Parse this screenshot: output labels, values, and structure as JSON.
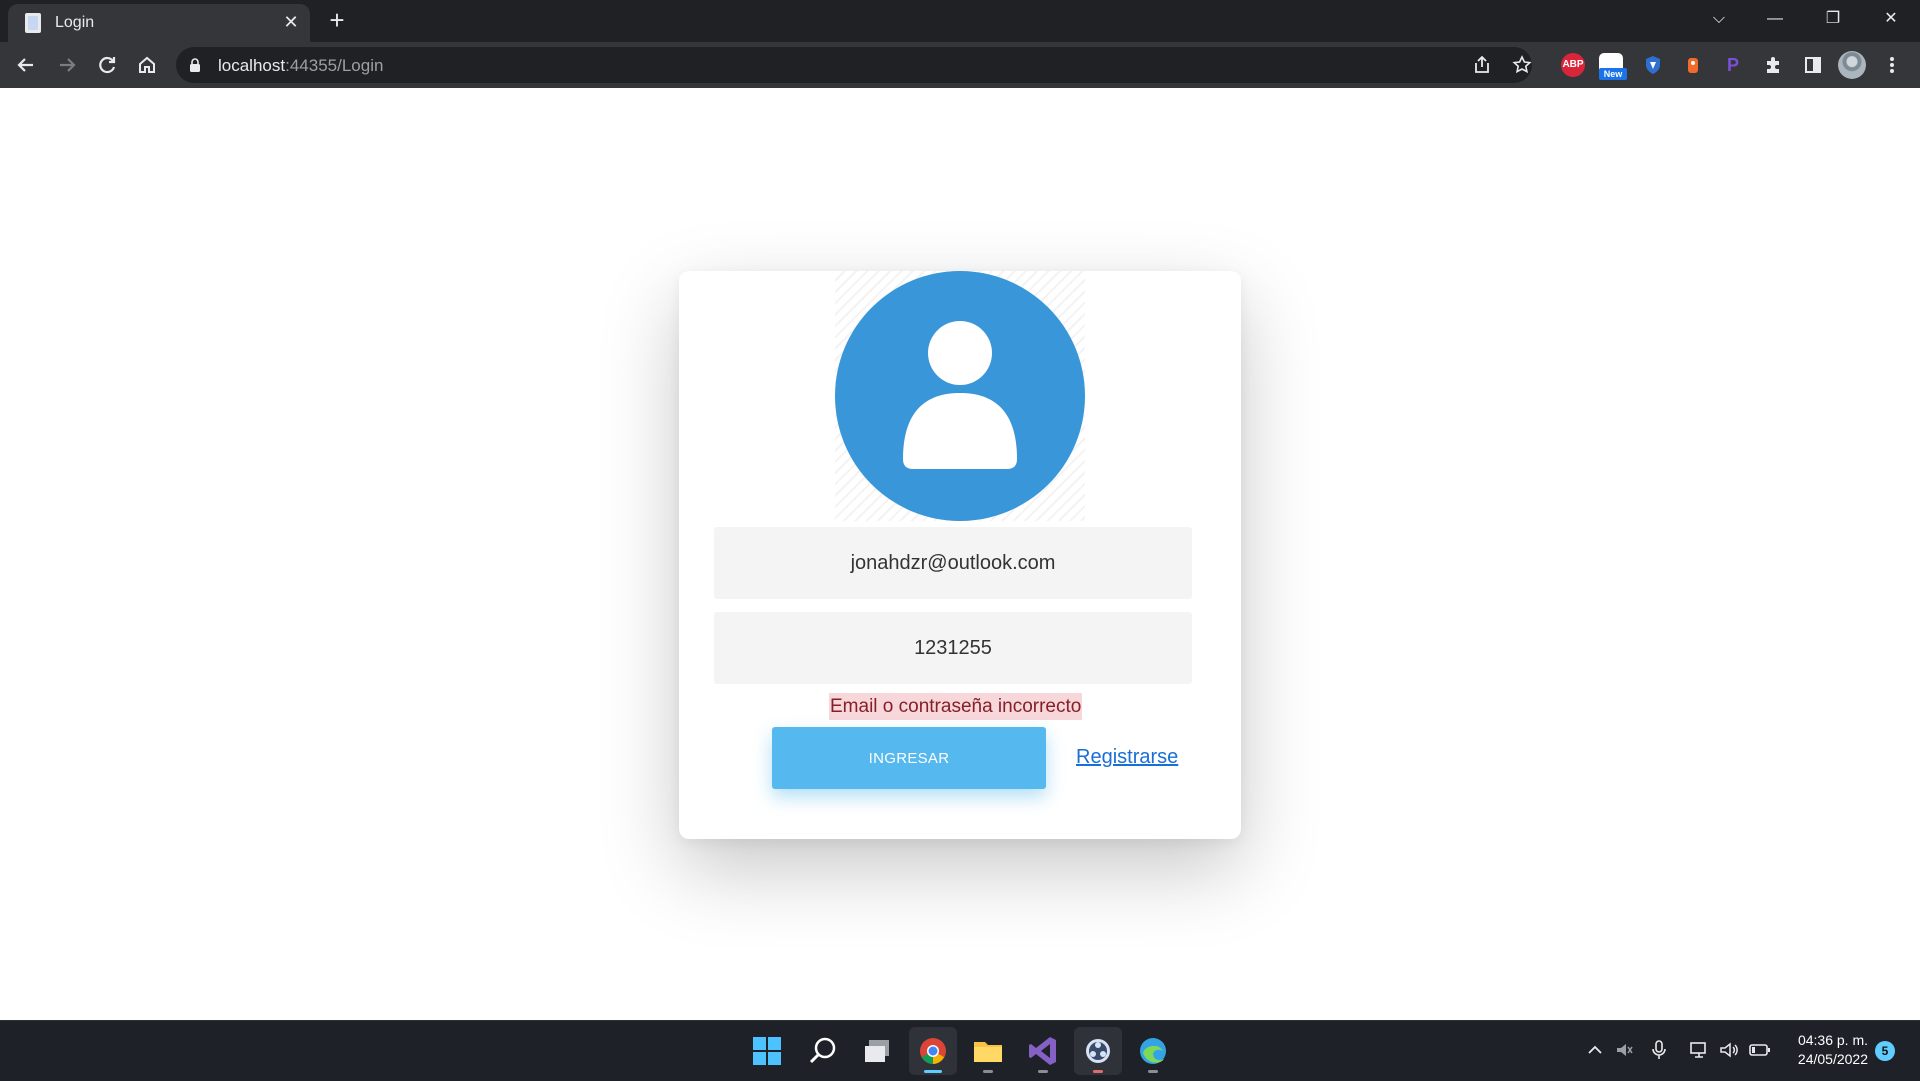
{
  "browser": {
    "tab_title": "Login",
    "tab_close": "✕",
    "new_tab": "+",
    "url_host": "localhost",
    "url_rest": ":44355/Login",
    "window_controls": [
      "⌵",
      "—",
      "❐",
      "✕"
    ],
    "extensions": [
      {
        "name": "adblock-plus-icon",
        "label": "ABP",
        "color": "#d9253a"
      },
      {
        "name": "new-extension-icon",
        "label": "",
        "badge": "New",
        "color": "#ffffff"
      },
      {
        "name": "shield-extension-icon",
        "label": "",
        "color": "#2f6fd0"
      },
      {
        "name": "bear-extension-icon",
        "label": "",
        "color": "#f36b2b"
      },
      {
        "name": "p-extension-icon",
        "label": "P",
        "color": "#6f42c1"
      }
    ]
  },
  "login": {
    "email_value": "jonahdzr@outlook.com",
    "password_value": "1231255",
    "error_message": "Email o contraseña incorrecto",
    "submit_label": "INGRESAR",
    "register_label": "Registrarse"
  },
  "colors": {
    "avatar_blue": "#3996d9",
    "button_blue": "#55b8ee",
    "error_bg": "#f8d7da",
    "error_text": "#842029",
    "link_blue": "#1a6fd6"
  },
  "taskbar": {
    "apps": [
      "windows-start-icon",
      "search-icon",
      "task-view-icon",
      "chrome-icon",
      "file-explorer-icon",
      "visual-studio-icon",
      "obs-icon",
      "edge-dev-icon"
    ],
    "time": "04:36 p. m.",
    "date": "24/05/2022",
    "notification_count": "5"
  }
}
